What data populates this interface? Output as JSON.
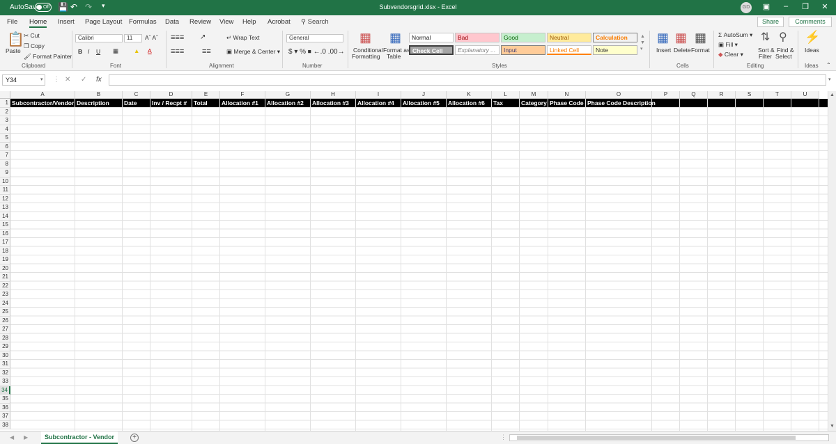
{
  "titlebar": {
    "autosave_label": "AutoSave",
    "autosave_state": "Off",
    "doc_title": "Subvendorsgrid.xlsx  -  Excel",
    "avatar": "GD"
  },
  "tabs": [
    "File",
    "Home",
    "Insert",
    "Page Layout",
    "Formulas",
    "Data",
    "Review",
    "View",
    "Help",
    "Acrobat"
  ],
  "search_label": "Search",
  "share_label": "Share",
  "comments_label": "Comments",
  "ribbon": {
    "clipboard": {
      "paste": "Paste",
      "cut": "Cut",
      "copy": "Copy",
      "format_painter": "Format Painter",
      "label": "Clipboard"
    },
    "font": {
      "name": "Calibri",
      "size": "11",
      "label": "Font"
    },
    "alignment": {
      "wrap": "Wrap Text",
      "merge": "Merge & Center",
      "label": "Alignment"
    },
    "number": {
      "format": "General",
      "label": "Number"
    },
    "styles": {
      "cond": "Conditional\nFormatting",
      "cond_l1": "Conditional",
      "cond_l2": "Formatting",
      "fmt_l1": "Format as",
      "fmt_l2": "Table",
      "label": "Styles",
      "cells": [
        "Normal",
        "Bad",
        "Good",
        "Neutral",
        "Calculation",
        "Check Cell",
        "Explanatory ...",
        "Input",
        "Linked Cell",
        "Note"
      ]
    },
    "cells": {
      "insert": "Insert",
      "delete": "Delete",
      "format": "Format",
      "label": "Cells"
    },
    "editing": {
      "autosum": "AutoSum",
      "fill": "Fill",
      "clear": "Clear",
      "sort": "Sort &",
      "sort2": "Filter",
      "find": "Find &",
      "find2": "Select",
      "label": "Editing"
    },
    "ideas": {
      "label": "Ideas",
      "button": "Ideas"
    }
  },
  "formula_bar": {
    "name_box": "Y34",
    "formula": ""
  },
  "columns": [
    "A",
    "B",
    "C",
    "D",
    "E",
    "F",
    "G",
    "H",
    "I",
    "J",
    "K",
    "L",
    "M",
    "N",
    "O",
    "P",
    "Q",
    "R",
    "S",
    "T",
    "U"
  ],
  "header_values": [
    "Subcontractor/Vendor",
    "Description",
    "Date",
    "Inv / Recpt #",
    "Total",
    "Allocation #1",
    "Allocation #2",
    "Allocation #3",
    "Allocation #4",
    "Allocation #5",
    "Allocation #6",
    "Tax",
    "Category",
    "Phase Code",
    "Phase Code Description"
  ],
  "selected_row": 34,
  "row_count": 38,
  "sheet_tab": "Subcontractor - Vendor"
}
